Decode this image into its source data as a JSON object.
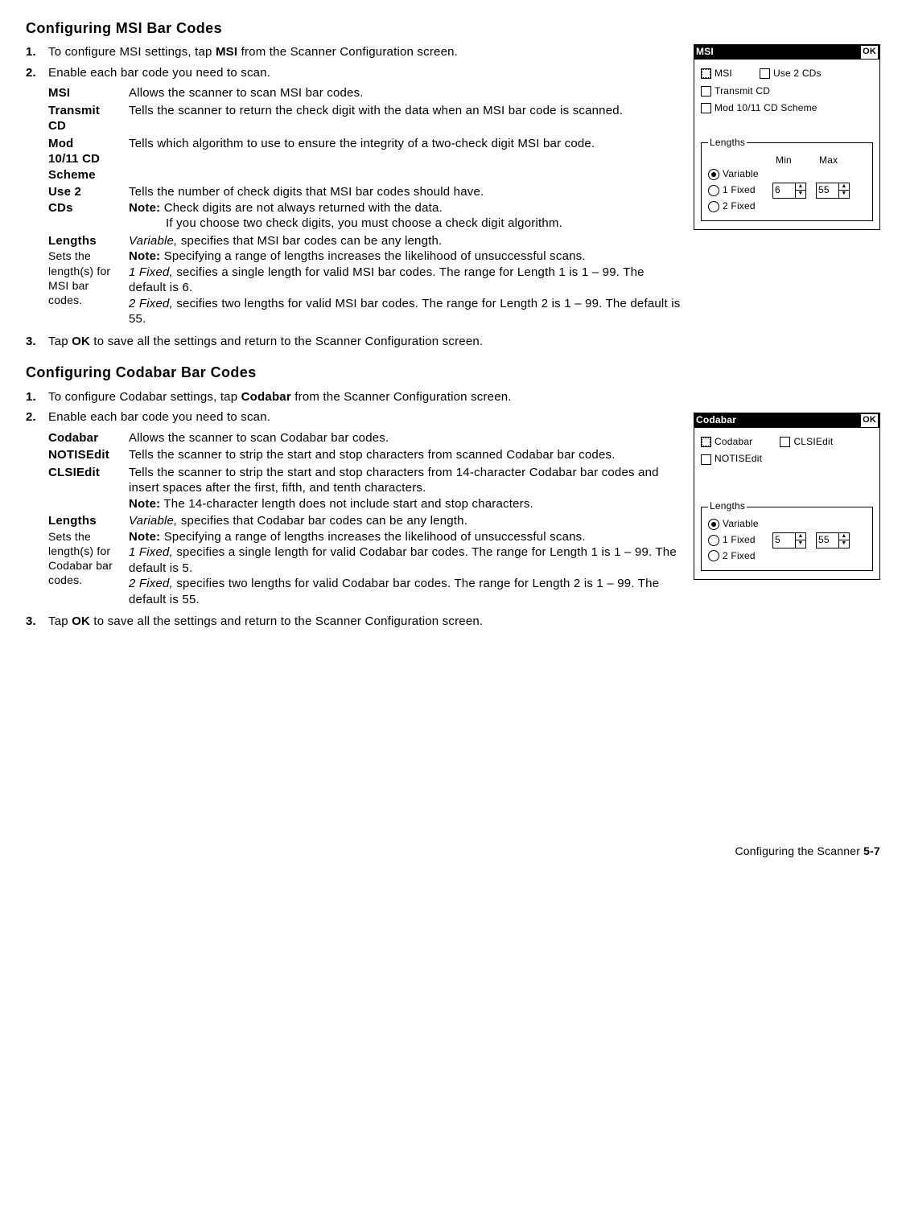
{
  "section_msi": {
    "heading": "Configuring MSI Bar Codes",
    "step1_pre": "To configure MSI settings, tap ",
    "step1_bold": "MSI",
    "step1_post": " from the Scanner Configuration screen.",
    "step2": "Enable each bar code you need to scan.",
    "defs": {
      "msi": {
        "term": "MSI",
        "desc": "Allows the scanner to scan MSI bar codes."
      },
      "transmit": {
        "term1": "Transmit",
        "term2": "CD",
        "desc": "Tells the scanner to return the check digit with the data when an MSI bar code is scanned."
      },
      "mod": {
        "term1": "Mod",
        "term2": "10/11 CD",
        "term3": "Scheme",
        "desc": "Tells which algorithm to use to ensure the integrity of a two-check digit MSI bar code."
      },
      "use2": {
        "term1": "Use 2",
        "term2": "CDs",
        "desc": "Tells the number of check digits that MSI bar codes should have.",
        "note_label": "Note:",
        "note": " Check digits are not always returned with the data.",
        "note2": "If you choose two check digits, you must choose a check digit algorithm."
      },
      "lengths": {
        "term": "Lengths",
        "sub": "Sets the length(s) for MSI bar codes.",
        "var_i": "Variable,",
        "var_rest": " specifies that MSI bar codes can be any length.",
        "note_label": "Note:",
        "note": " Specifying a range of lengths increases the likelihood of unsuccessful scans.",
        "f1_i": "1 Fixed,",
        "f1_rest": " secifies a single length for valid MSI bar codes.  The range for Length 1 is 1 – 99.  The default is 6.",
        "f2_i": "2 Fixed,",
        "f2_rest": " secifies two lengths for valid MSI bar codes.  The range for Length 2 is 1 – 99.  The default is 55."
      }
    },
    "step3_pre": "Tap ",
    "step3_bold": "OK",
    "step3_post": " to save all the settings and return to the Scanner Configuration screen."
  },
  "fig_msi": {
    "title": "MSI",
    "ok": "OK",
    "chk_msi": "MSI",
    "chk_use2": "Use 2 CDs",
    "chk_transmit": "Transmit CD",
    "chk_mod": "Mod 10/11 CD Scheme",
    "lengths_legend": "Lengths",
    "hdr_min": "Min",
    "hdr_max": "Max",
    "r_variable": "Variable",
    "r_1fixed": "1 Fixed",
    "r_2fixed": "2 Fixed",
    "spin_min": "6",
    "spin_max": "55"
  },
  "section_codabar": {
    "heading": "Configuring Codabar Bar Codes",
    "step1_pre": "To configure Codabar settings, tap ",
    "step1_bold": "Codabar",
    "step1_post": " from the Scanner Configuration screen.",
    "step2": "Enable each bar code you need to scan.",
    "defs": {
      "codabar": {
        "term": "Codabar",
        "desc": "Allows the scanner to scan Codabar bar codes."
      },
      "notis": {
        "term": "NOTISEdit",
        "desc": "Tells the scanner to strip the start and stop characters from scanned Codabar bar codes."
      },
      "clsi": {
        "term": "CLSIEdit",
        "desc": "Tells the scanner to strip the start and stop characters from 14-character Codabar bar codes and insert spaces after the first, fifth, and tenth characters.",
        "note_label": "Note:",
        "note": " The 14-character length does not include start and stop characters."
      },
      "lengths": {
        "term": "Lengths",
        "sub": "Sets the length(s) for Codabar bar codes.",
        "var_i": "Variable,",
        "var_rest": " specifies that Codabar bar codes can be any length.",
        "note_label": "Note:",
        "note": " Specifying a range of lengths increases the likelihood of unsuccessful scans.",
        "note2_indent": "",
        "f1_i": "1 Fixed,",
        "f1_rest": " specifies a single length for valid Codabar bar codes.  The range for Length 1 is 1 – 99.  The default is 5.",
        "f2_i": "2 Fixed,",
        "f2_rest": " specifies two lengths for valid Codabar bar codes.  The range for Length 2 is 1 – 99.  The default is 55."
      }
    },
    "step3_pre": "Tap ",
    "step3_bold": "OK",
    "step3_post": " to save all the settings and return to the Scanner Configuration screen."
  },
  "fig_codabar": {
    "title": "Codabar",
    "ok": "OK",
    "chk_codabar": "Codabar",
    "chk_clsi": "CLSIEdit",
    "chk_notis": "NOTISEdit",
    "lengths_legend": "Lengths",
    "r_variable": "Variable",
    "r_1fixed": "1 Fixed",
    "r_2fixed": "2 Fixed",
    "spin_min": "5",
    "spin_max": "55"
  },
  "footer": {
    "text": "Configuring the Scanner  ",
    "page": "5-7"
  },
  "numbers": {
    "n1": "1.",
    "n2": "2.",
    "n3": "3."
  }
}
